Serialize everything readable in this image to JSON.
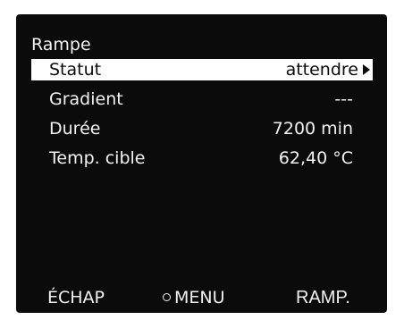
{
  "screen": {
    "title": "Rampe",
    "rows": [
      {
        "label": "Statut",
        "value": "attendre",
        "selected": true
      },
      {
        "label": "Gradient",
        "value": "---",
        "selected": false
      },
      {
        "label": "Durée",
        "value": "7200 min",
        "selected": false
      },
      {
        "label": "Temp. cible",
        "value": "62,40 °C",
        "selected": false
      }
    ],
    "footer": {
      "left": "ÉCHAP",
      "center": "MENU",
      "right": "RAMP."
    },
    "colors": {
      "background": "#0b0b0b",
      "text": "#f2f2f2",
      "highlight": "#ffffff"
    },
    "icons": {
      "selected_row_indicator": "triangle-right-icon",
      "menu_key_indicator": "circle-icon"
    }
  }
}
